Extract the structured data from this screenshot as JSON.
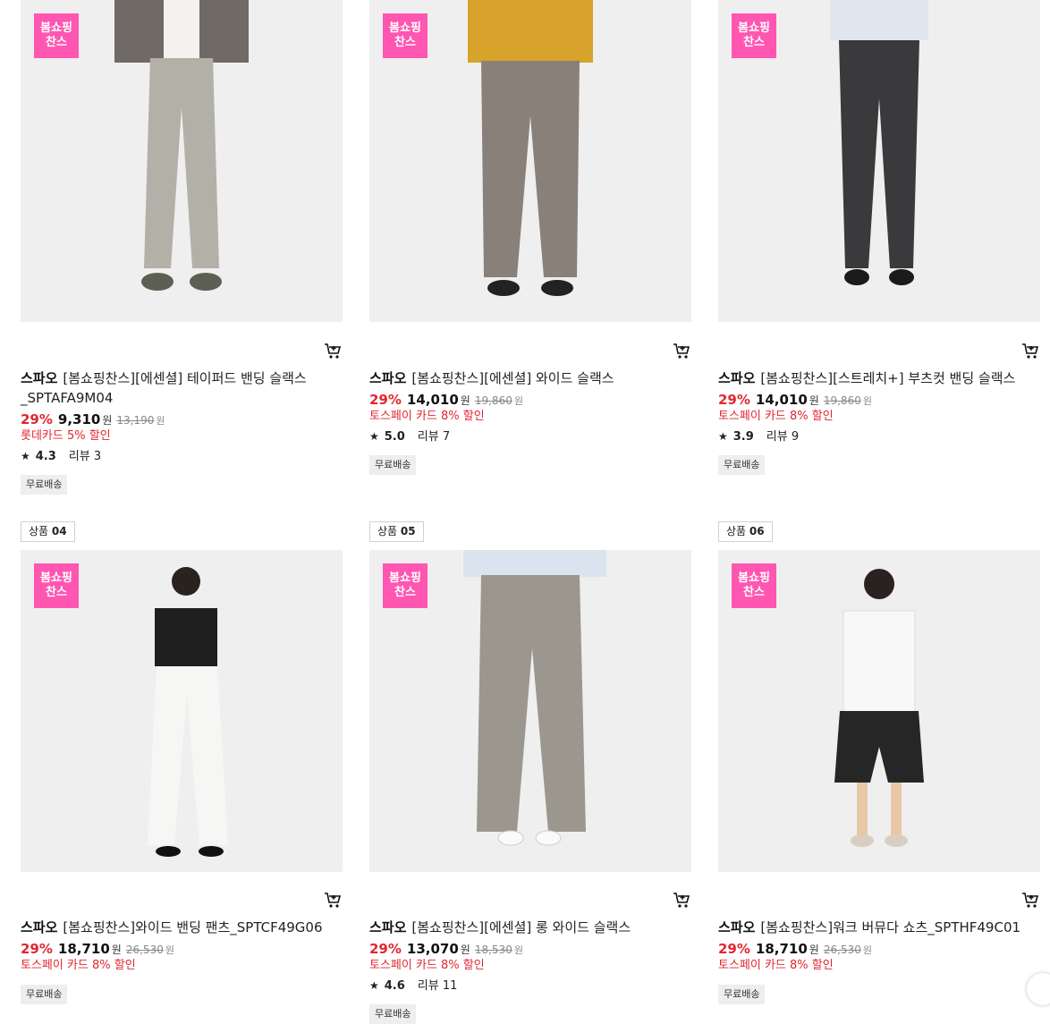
{
  "badge_text": "봄쇼핑\n찬스",
  "free_shipping_label": "무료배송",
  "review_label": "리뷰",
  "won_label": "원",
  "rank_prefix": "상품",
  "products": [
    {
      "rank": "",
      "brand": "스파오",
      "title": "[봄쇼핑찬스][에센셜] 테이퍼드 밴딩 슬랙스_SPTAFA9M04",
      "rate": "29%",
      "price": "9,310",
      "orig": "13,190",
      "promo": "롯데카드 5% 할인",
      "rating": "4.3",
      "reviews": "3",
      "free_shipping": true
    },
    {
      "rank": "",
      "brand": "스파오",
      "title": "[봄쇼핑찬스][에센셜] 와이드 슬랙스",
      "rate": "29%",
      "price": "14,010",
      "orig": "19,860",
      "promo": "토스페이 카드 8% 할인",
      "rating": "5.0",
      "reviews": "7",
      "free_shipping": true
    },
    {
      "rank": "",
      "brand": "스파오",
      "title": "[봄쇼핑찬스][스트레치+] 부츠컷 밴딩 슬랙스",
      "rate": "29%",
      "price": "14,010",
      "orig": "19,860",
      "promo": "토스페이 카드 8% 할인",
      "rating": "3.9",
      "reviews": "9",
      "free_shipping": true
    },
    {
      "rank": "04",
      "brand": "스파오",
      "title": "[봄쇼핑찬스]와이드 밴딩 팬츠_SPTCF49G06",
      "rate": "29%",
      "price": "18,710",
      "orig": "26,530",
      "promo": "토스페이 카드 8% 할인",
      "rating": "",
      "reviews": "",
      "free_shipping": true
    },
    {
      "rank": "05",
      "brand": "스파오",
      "title": "[봄쇼핑찬스][에센셜] 롱 와이드 슬랙스",
      "rate": "29%",
      "price": "13,070",
      "orig": "18,530",
      "promo": "토스페이 카드 8% 할인",
      "rating": "4.6",
      "reviews": "11",
      "free_shipping": true
    },
    {
      "rank": "06",
      "brand": "스파오",
      "title": "[봄쇼핑찬스]워크 버뮤다 쇼츠_SPTHF49C01",
      "rate": "29%",
      "price": "18,710",
      "orig": "26,530",
      "promo": "토스페이 카드 8% 할인",
      "rating": "",
      "reviews": "",
      "free_shipping": true
    }
  ]
}
